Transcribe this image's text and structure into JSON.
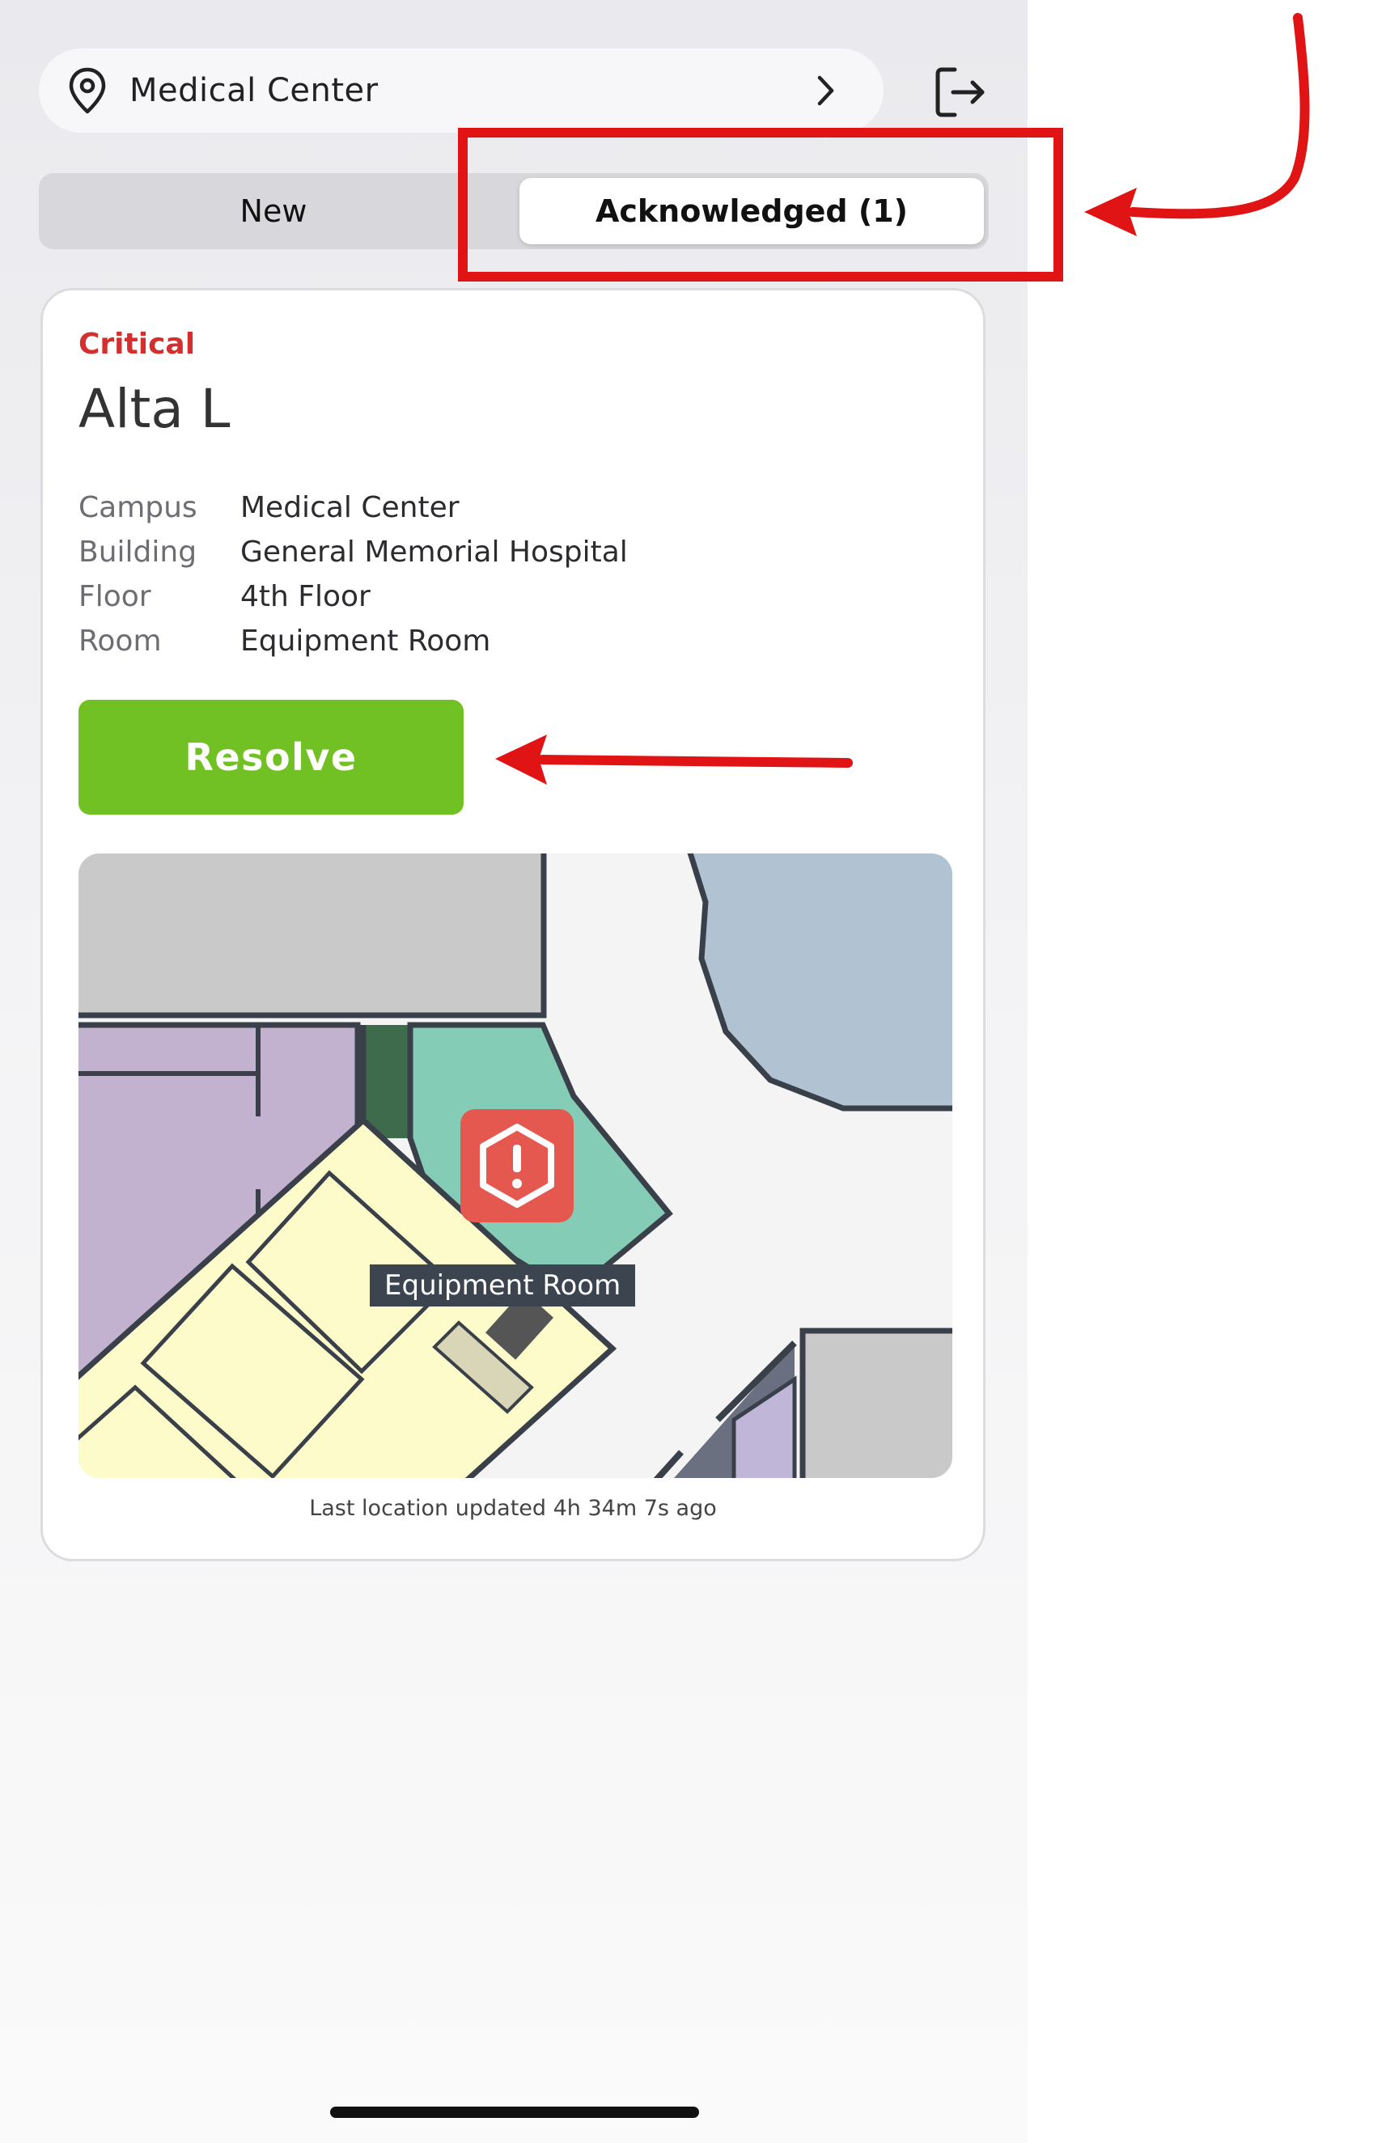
{
  "header": {
    "location_label": "Medical Center",
    "location_icon": "map-pin-icon",
    "chevron_icon": "chevron-right-icon",
    "logout_icon": "logout-icon"
  },
  "tabs": [
    {
      "label": "New",
      "selected": false
    },
    {
      "label": "Acknowledged (1)",
      "selected": true
    }
  ],
  "alert": {
    "severity": "Critical",
    "severity_color": "#d32f2f",
    "name": "Alta L",
    "details": [
      {
        "label": "Campus",
        "value": "Medical Center"
      },
      {
        "label": "Building",
        "value": "General Memorial Hospital"
      },
      {
        "label": "Floor",
        "value": "4th Floor"
      },
      {
        "label": "Room",
        "value": "Equipment Room"
      }
    ],
    "resolve_label": "Resolve",
    "resolve_color": "#72c124",
    "map": {
      "room_tag": "Equipment Room",
      "marker_icon": "alert-hexagon-icon",
      "marker_color": "#e5584f"
    },
    "last_updated": "Last location updated 4h 34m 7s ago"
  },
  "annotation_color": "#e01414"
}
